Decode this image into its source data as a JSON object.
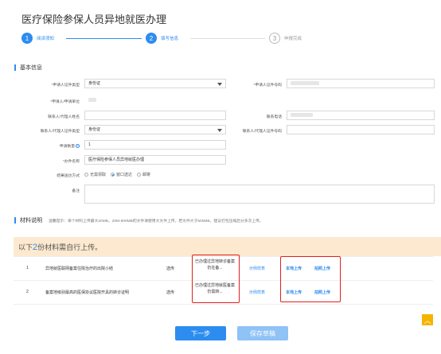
{
  "page_title": "医疗保险参保人员异地就医办理",
  "steps": [
    {
      "num": "1",
      "label": "阅读须知",
      "state": "done"
    },
    {
      "num": "2",
      "label": "填写信息",
      "state": "active"
    },
    {
      "num": "3",
      "label": "申报完成",
      "state": "pending"
    }
  ],
  "basic_info": {
    "heading": "基本信息",
    "applicant_id_type_label": "申请人证件类型",
    "applicant_id_type_value": "身份证",
    "applicant_id_no_label": "申请人证件号码",
    "applicant_unit_label": "申请人/申请单位",
    "contact_name_label": "联系人/代理人姓名",
    "contact_phone_label": "联系电话",
    "contact_id_type_label": "联系人/代理人证件类型",
    "contact_id_type_value": "身份证",
    "contact_id_no_label": "联系人/代理人证件号码",
    "apply_count_label": "申请数量",
    "apply_count_value": "1",
    "item_name_label": "办件名称",
    "item_name_value": "医疗保险参保人员异地就医办理",
    "delivery_label": "结果送达方式",
    "delivery_options": [
      "无需领取",
      "窗口送达",
      "邮寄"
    ],
    "delivery_selected": "窗口送达",
    "remark_label": "备注"
  },
  "materials": {
    "heading": "材料说明",
    "tip": "温馨提示：单个材料上传最大20MB，20M-500MB的文件请使用大文件上传，若文件大于500MB，建议打包压缩后分多次上传。",
    "banner_prefix": "以下",
    "banner_count": "2",
    "banner_suffix": "份材料需自行上传。",
    "rows": [
      {
        "idx": "1",
        "name": "异地就医联网备案住院治疗的出院小结",
        "required": "选传",
        "note": "已办理过异地转诊备案仍在备...",
        "sample": "示例样表",
        "upload_local": "本地上传",
        "upload_photo": "拍照上传"
      },
      {
        "idx": "2",
        "name": "备案地级别最高的医保协议医院开具的转诊证明",
        "required": "选传",
        "note": "已办理过异地就医备案仍需转...",
        "sample": "示例样表",
        "upload_local": "本地上传",
        "upload_photo": "拍照上传"
      }
    ]
  },
  "buttons": {
    "next": "下一步",
    "save_draft": "保存草稿"
  },
  "colors": {
    "accent": "#2d8cf0",
    "banner_bg": "#fce9cf",
    "highlight_box": "#e02020",
    "back_to_top": "#f5b400"
  },
  "icons": {
    "back_to_top": "chevron-up-icon",
    "help": "help-icon"
  }
}
